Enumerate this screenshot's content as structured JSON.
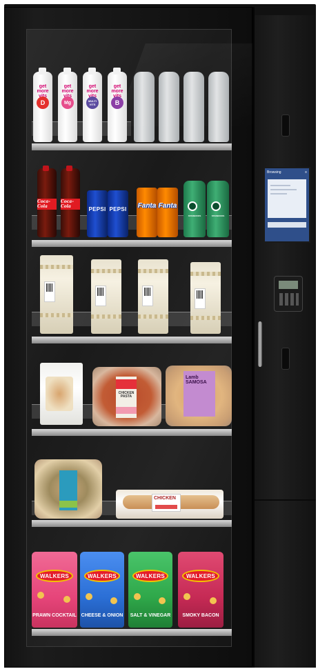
{
  "row1": {
    "vitamin_brand": "get more vits",
    "vitamins": [
      {
        "letter": "D",
        "color": "#e4302c"
      },
      {
        "letter": "Mg",
        "color": "#e64d8b"
      },
      {
        "letter": "MULTI VITS",
        "color": "#5b4ba0"
      },
      {
        "letter": "B",
        "color": "#8c3fa6"
      }
    ]
  },
  "row2": {
    "cola_brand": "Coca-Cola",
    "can1_brand": "PEPSI",
    "can2_brand": "Fanta",
    "drink_brand": "STARBUCKS"
  },
  "row4": {
    "pot_label": "CHICKEN PASTA",
    "samosa_label": "Lamb SAMOSA"
  },
  "row5": {
    "tray_label": "CHICKEN"
  },
  "row6": {
    "crisps_brand": "WALKERS",
    "flavours": [
      {
        "name": "PRAWN COCKTAIL",
        "color": "#e6457a"
      },
      {
        "name": "CHEESE & ONION",
        "color": "#2b6fd6"
      },
      {
        "name": "SALT & VINEGAR",
        "color": "#2fa84a"
      },
      {
        "name": "SMOKY BACON",
        "color": "#c62a55"
      }
    ]
  },
  "screen": {
    "header": "Browsing"
  }
}
